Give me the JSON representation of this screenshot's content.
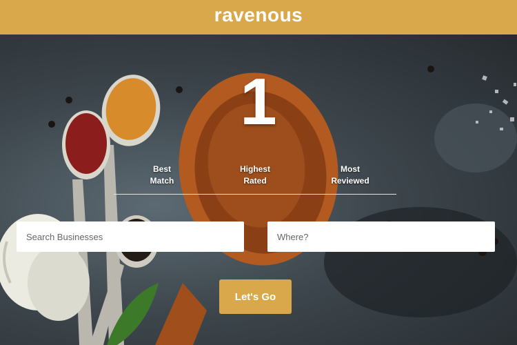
{
  "header": {
    "logo": "ravenous"
  },
  "hero": {
    "highlight_number": "1"
  },
  "sort_options": [
    {
      "line1": "Best",
      "line2": "Match"
    },
    {
      "line1": "Highest",
      "line2": "Rated"
    },
    {
      "line1": "Most",
      "line2": "Reviewed"
    }
  ],
  "search": {
    "term_placeholder": "Search Businesses",
    "location_placeholder": "Where?",
    "submit_label": "Let's Go"
  },
  "colors": {
    "brand": "#d9a84a",
    "background": "#2d3236"
  }
}
